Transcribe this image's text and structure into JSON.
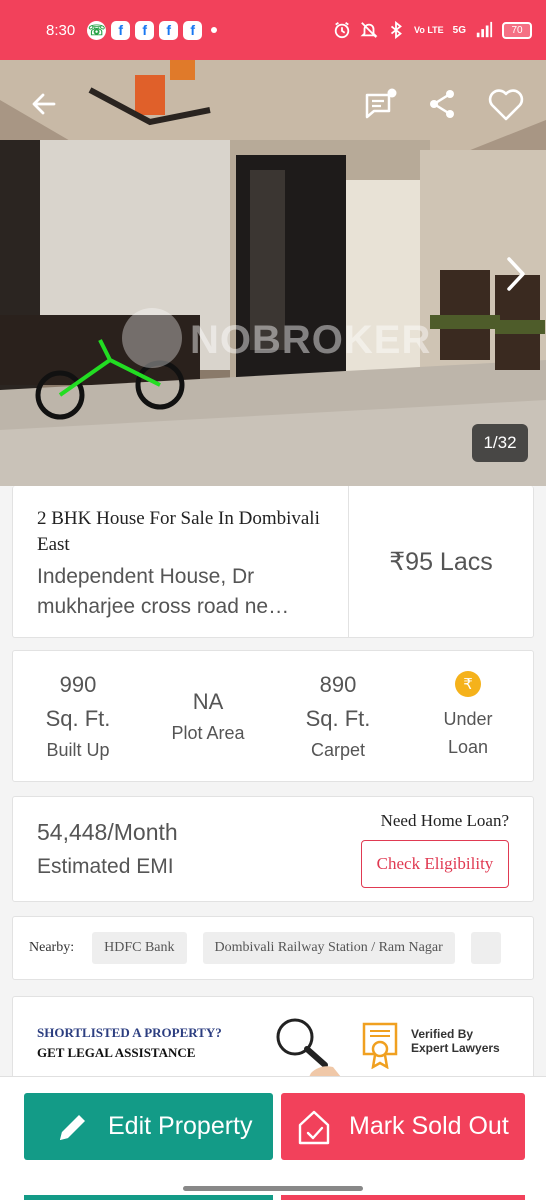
{
  "status_bar": {
    "time": "8:30",
    "notification_icons": [
      "whatsapp-icon",
      "facebook-icon",
      "facebook-icon",
      "facebook-icon",
      "facebook-icon"
    ],
    "network": "Vo LTE",
    "network_type": "5G",
    "battery": "70",
    "color": "#f2415b"
  },
  "hero": {
    "counter": "1/32",
    "watermark": "NOBROKER"
  },
  "listing": {
    "title": "2 BHK House For Sale In Dombivali East",
    "subtitle_line1": "Independent House, Dr",
    "subtitle_line2": "mukharjee cross road ne…",
    "price": "₹95 Lacs"
  },
  "stats": [
    {
      "value": "990",
      "unit": "Sq. Ft.",
      "label": "Built Up"
    },
    {
      "value": "NA",
      "unit": "",
      "label": "Plot Area"
    },
    {
      "value": "890",
      "unit": "Sq. Ft.",
      "label": "Carpet"
    },
    {
      "icon": "rupee-icon",
      "label_line1": "Under",
      "label_line2": "Loan"
    }
  ],
  "emi": {
    "value": "54,448/Month",
    "label": "Estimated EMI",
    "loan_question": "Need Home Loan?",
    "check_button": "Check Eligibility"
  },
  "nearby": {
    "label": "Nearby:",
    "places": [
      "HDFC Bank",
      "Dombivali Railway Station / Ram Nagar"
    ]
  },
  "legal_banner": {
    "line1": "SHORTLISTED A PROPERTY?",
    "line2": "GET LEGAL ASSISTANCE",
    "verified_line1": "Verified By",
    "verified_line2": "Expert Lawyers"
  },
  "actions": {
    "edit_label": "Edit Property",
    "sold_label": "Mark Sold Out",
    "edit_color": "#139b87",
    "sold_color": "#f2415b"
  }
}
